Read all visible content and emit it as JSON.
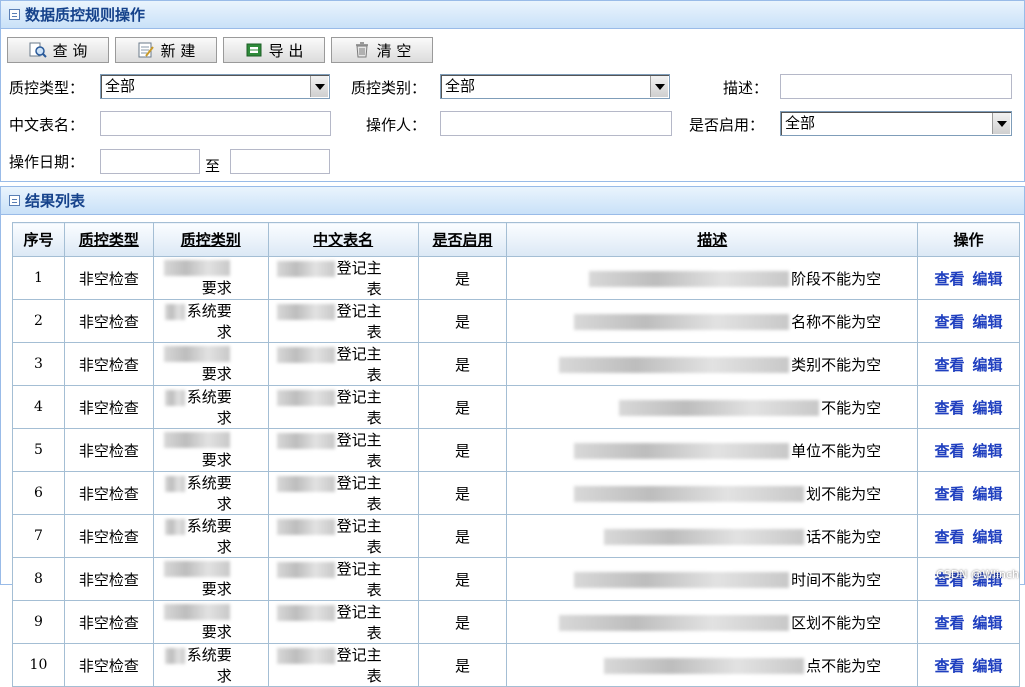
{
  "top_panel": {
    "title": "数据质控规则操作"
  },
  "toolbar": {
    "buttons": [
      {
        "label": "查 询",
        "icon": "search-icon"
      },
      {
        "label": "新 建",
        "icon": "new-document-icon"
      },
      {
        "label": "导 出",
        "icon": "export-icon"
      },
      {
        "label": "清 空",
        "icon": "trash-icon"
      }
    ]
  },
  "filters": {
    "qc_type_label": "质控类型：",
    "qc_type_value": "全部",
    "qc_category_label": "质控类别：",
    "qc_category_value": "全部",
    "desc_label": "描述：",
    "desc_value": "",
    "table_name_label": "中文表名：",
    "table_name_value": "",
    "operator_label": "操作人：",
    "operator_value": "",
    "enabled_label": "是否启用：",
    "enabled_value": "全部",
    "date_label": "操作日期：",
    "date_from": "",
    "date_to_label": "至",
    "date_to": ""
  },
  "result_panel": {
    "title": "结果列表"
  },
  "table": {
    "headers": [
      "序号",
      "质控类型",
      "质控类别",
      "中文表名",
      "是否启用",
      "描述",
      "操作"
    ],
    "view_label": "查看",
    "edit_label": "编辑",
    "rows": [
      {
        "no": "1",
        "type": "非空检查",
        "category": "要求",
        "table": "登记主表",
        "enabled": "是",
        "desc": "阶段不能为空"
      },
      {
        "no": "2",
        "type": "非空检查",
        "category": "系统要求",
        "table": "登记主表",
        "enabled": "是",
        "desc": "名称不能为空"
      },
      {
        "no": "3",
        "type": "非空检查",
        "category": "要求",
        "table": "登记主表",
        "enabled": "是",
        "desc": "类别不能为空"
      },
      {
        "no": "4",
        "type": "非空检查",
        "category": "系统要求",
        "table": "登记主表",
        "enabled": "是",
        "desc": "不能为空"
      },
      {
        "no": "5",
        "type": "非空检查",
        "category": "要求",
        "table": "登记主表",
        "enabled": "是",
        "desc": "单位不能为空"
      },
      {
        "no": "6",
        "type": "非空检查",
        "category": "系统要求",
        "table": "登记主表",
        "enabled": "是",
        "desc": "划不能为空"
      },
      {
        "no": "7",
        "type": "非空检查",
        "category": "系统要求",
        "table": "登记主表",
        "enabled": "是",
        "desc": "话不能为空"
      },
      {
        "no": "8",
        "type": "非空检查",
        "category": "要求",
        "table": "登记主表",
        "enabled": "是",
        "desc": "时间不能为空"
      },
      {
        "no": "9",
        "type": "非空检查",
        "category": "要求",
        "table": "登记主表",
        "enabled": "是",
        "desc": "区划不能为空"
      },
      {
        "no": "10",
        "type": "非空检查",
        "category": "系统要求",
        "table": "登记主表",
        "enabled": "是",
        "desc": "点不能为空"
      }
    ]
  },
  "watermark": "CSDN @Wlinch"
}
